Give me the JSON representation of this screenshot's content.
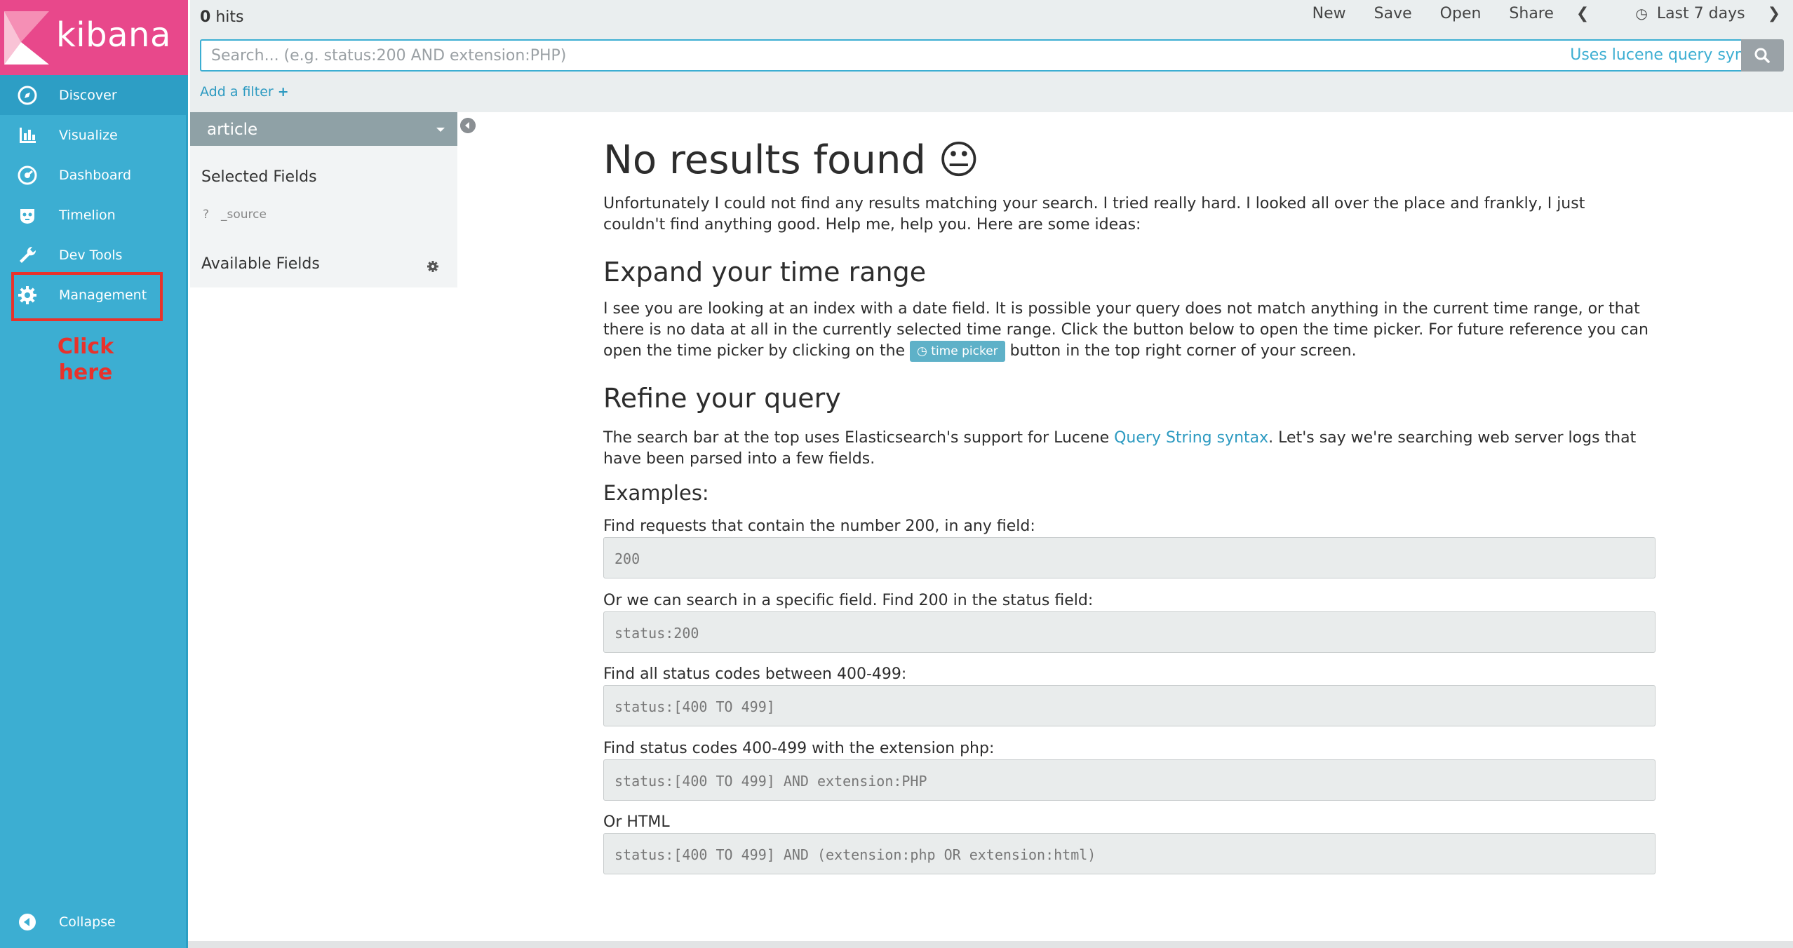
{
  "sidebar": {
    "brand": "kibana",
    "items": [
      {
        "label": "Discover",
        "icon": "compass-icon"
      },
      {
        "label": "Visualize",
        "icon": "bar-chart-icon"
      },
      {
        "label": "Dashboard",
        "icon": "dashboard-icon"
      },
      {
        "label": "Timelion",
        "icon": "timelion-icon"
      },
      {
        "label": "Dev Tools",
        "icon": "wrench-icon"
      },
      {
        "label": "Management",
        "icon": "gear-icon"
      }
    ],
    "collapse_label": "Collapse",
    "annotation": "Click here",
    "colors": {
      "sidebar": "#3caed2",
      "brand": "#e8488b",
      "annotation": "#e8322b"
    }
  },
  "topbar": {
    "hits_count": "0",
    "hits_label": "hits",
    "menu": [
      "New",
      "Save",
      "Open",
      "Share"
    ],
    "time_range": "Last 7 days",
    "search_placeholder": "Search... (e.g. status:200 AND extension:PHP)",
    "lucene_hint": "Uses lucene query syntax",
    "add_filter": "Add a filter"
  },
  "fields": {
    "index": "article",
    "selected_title": "Selected Fields",
    "source_type": "?",
    "source_field": "_source",
    "available_title": "Available Fields"
  },
  "main": {
    "title": "No results found 😐",
    "intro": "Unfortunately I could not find any results matching your search. I tried really hard. I looked all over the place and frankly, I just couldn't find anything good. Help me, help you. Here are some ideas:",
    "expand_title": "Expand your time range",
    "expand_text_1": "I see you are looking at an index with a date field. It is possible your query does not match anything in the current time range, or that there is no data at all in the currently selected time range. Click the button below to open the time picker. For future reference you can open the time picker by clicking on the",
    "time_picker_label": "time picker",
    "expand_text_2": "button in the top right corner of your screen.",
    "refine_title": "Refine your query",
    "refine_text_1": "The search bar at the top uses Elasticsearch's support for Lucene",
    "refine_link": "Query String syntax",
    "refine_text_2": ". Let's say we're searching web server logs that have been parsed into a few fields.",
    "examples_title": "Examples:",
    "examples": [
      {
        "label": "Find requests that contain the number 200, in any field:",
        "code": "200"
      },
      {
        "label": "Or we can search in a specific field. Find 200 in the status field:",
        "code": "status:200"
      },
      {
        "label": "Find all status codes between 400-499:",
        "code": "status:[400 TO 499]"
      },
      {
        "label": "Find status codes 400-499 with the extension php:",
        "code": "status:[400 TO 499] AND extension:PHP"
      },
      {
        "label": "Or HTML",
        "code": "status:[400 TO 499] AND (extension:php OR extension:html)"
      }
    ]
  }
}
